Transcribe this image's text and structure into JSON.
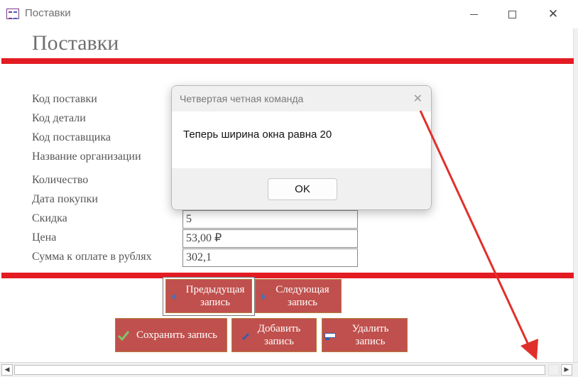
{
  "window": {
    "title": "Поставки"
  },
  "form": {
    "title": "Поставки",
    "fields": [
      {
        "label": "Код поставки",
        "value": ""
      },
      {
        "label": "Код детали",
        "value": ""
      },
      {
        "label": "Код поставщика",
        "value": ""
      },
      {
        "label": "Название организации",
        "value": ""
      },
      {
        "label": "Количество",
        "value": ""
      },
      {
        "label": "Дата покупки",
        "value": ""
      },
      {
        "label": "Скидка",
        "value": "5"
      },
      {
        "label": "Цена",
        "value": "53,00 ₽"
      },
      {
        "label": "Сумма к оплате в рублях",
        "value": "302,1"
      }
    ],
    "buttons": {
      "prev": "Предыдущая запись",
      "next": "Следующая запись",
      "save": "Сохранить запись",
      "add": "Добавить запись",
      "delete": "Удалить запись"
    }
  },
  "dialog": {
    "title": "Четвертая четная команда",
    "message": "Теперь ширина окна равна 20",
    "ok": "OK"
  },
  "colors": {
    "accent_red": "#e31b23",
    "button_fill": "#c0504d",
    "annotation_arrow": "#e0302b"
  },
  "icons": {
    "window_controls": [
      "minimize-icon",
      "maximize-icon",
      "close-icon"
    ],
    "prev_button": "arrow-left-icon",
    "next_button": "arrow-right-icon",
    "save_button": "checkmark-icon",
    "add_button": "pencil-icon",
    "delete_button": "delete-record-icon"
  }
}
